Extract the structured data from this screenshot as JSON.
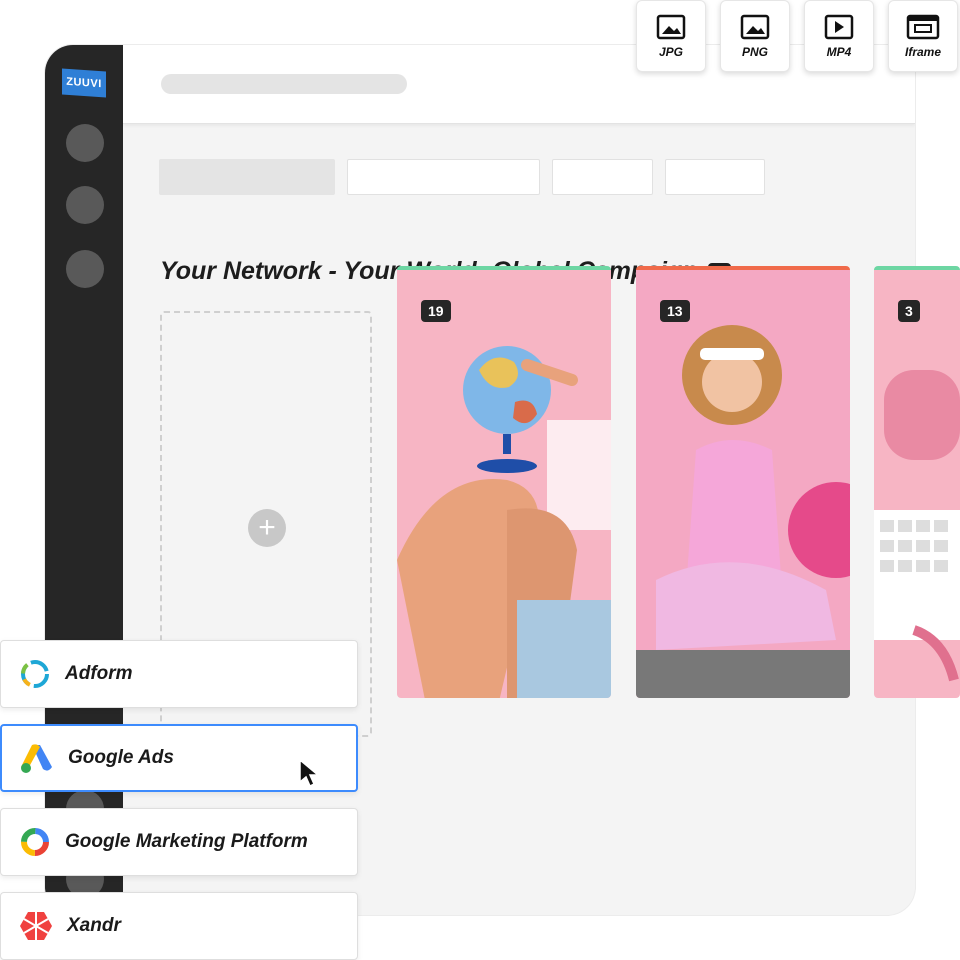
{
  "app": {
    "logo_text": "ZUUVI"
  },
  "export_buttons": [
    {
      "label": "JPG",
      "icon": "image-icon"
    },
    {
      "label": "PNG",
      "icon": "image-icon"
    },
    {
      "label": "MP4",
      "icon": "play-icon"
    },
    {
      "label": "Iframe",
      "icon": "iframe-icon"
    }
  ],
  "campaign": {
    "title": "Your Network - Your World: Global Campaign",
    "count": "19"
  },
  "cards": [
    {
      "count": "19",
      "accent": "#6dd6a3",
      "subject": "globe"
    },
    {
      "count": "13",
      "accent": "#f06a4a",
      "subject": "woman-exercise"
    },
    {
      "count": "3",
      "accent": "#6dd6a3",
      "subject": "phone-keyboard"
    }
  ],
  "partners": [
    {
      "label": "Adform",
      "icon": "adform-icon",
      "selected": false
    },
    {
      "label": "Google Ads",
      "icon": "google-ads-icon",
      "selected": true
    },
    {
      "label": "Google Marketing Platform",
      "icon": "google-marketing-platform-icon",
      "selected": false
    },
    {
      "label": "Xandr",
      "icon": "xandr-icon",
      "selected": false
    }
  ],
  "colors": {
    "sidebar": "#262626",
    "card_bg": "#f7b5c4",
    "accent_green": "#6dd6a3",
    "accent_red": "#f06a4a",
    "selection_blue": "#3d8bfd"
  }
}
